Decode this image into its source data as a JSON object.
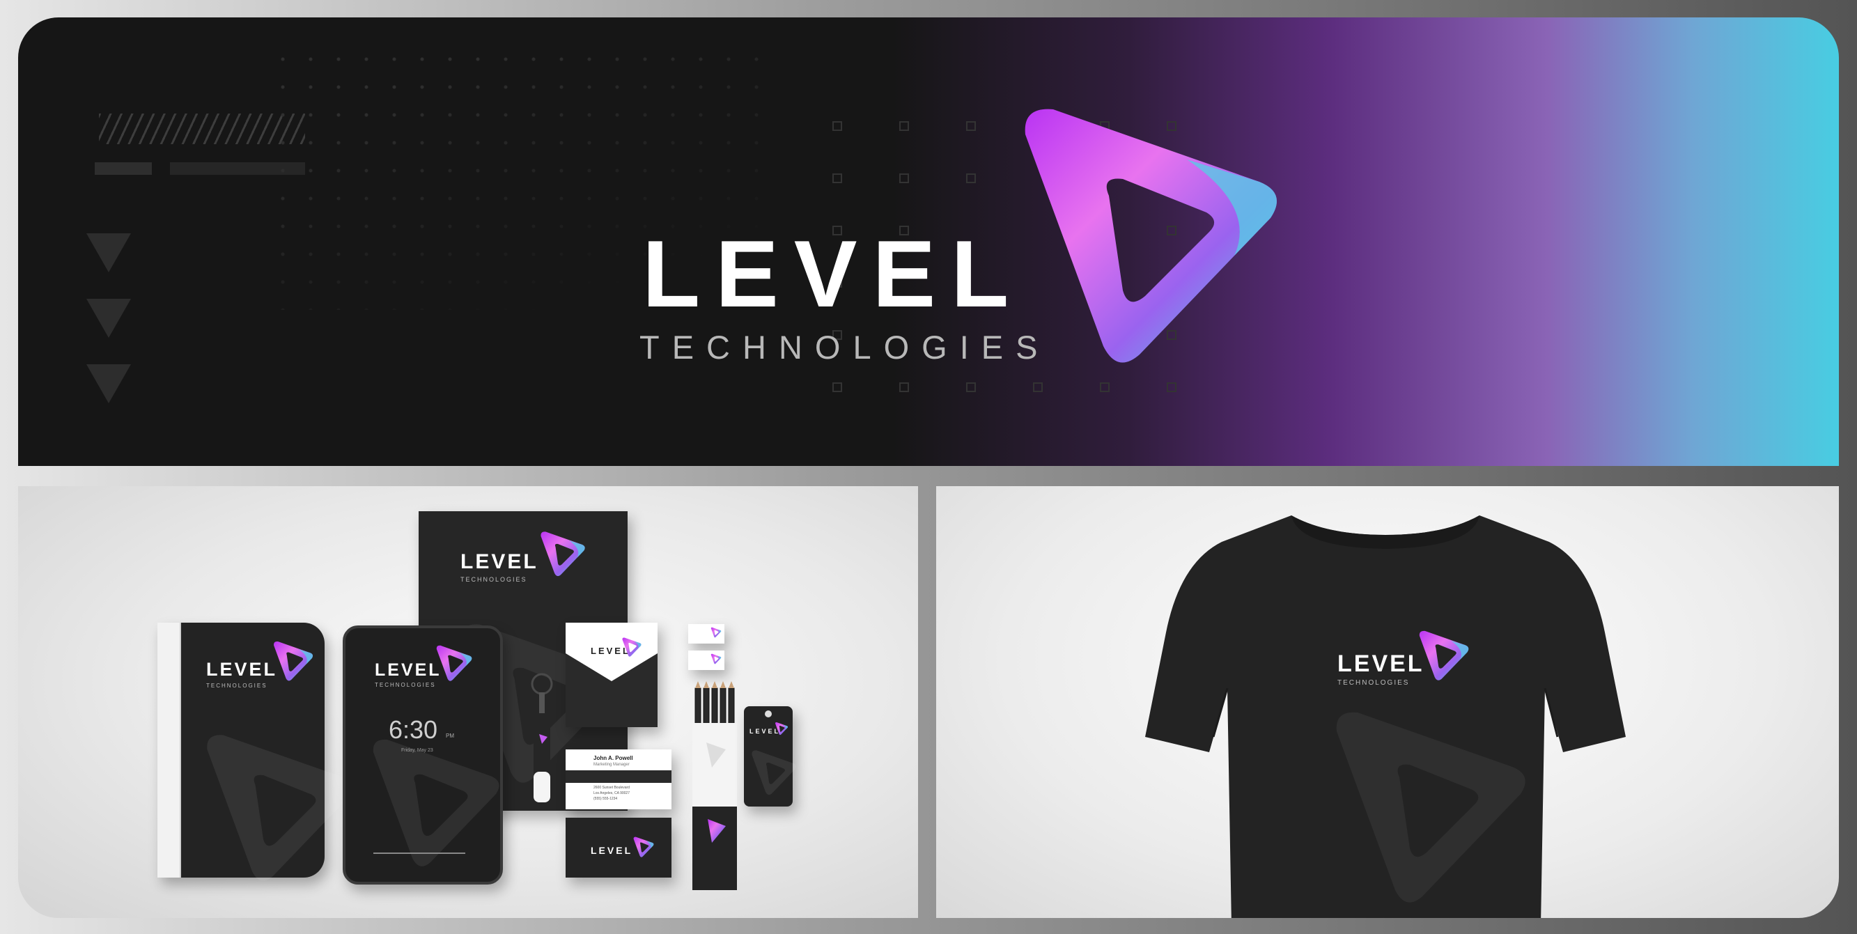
{
  "banner": {
    "brand_word": "LEVEL",
    "brand_sub": "TECHNOLOGIES"
  },
  "mockups": {
    "brand_word": "LEVEL",
    "brand_sub": "TECHNOLOGIES",
    "tablet_time": "6:30",
    "tablet_ampm": "PM",
    "tablet_date": "Friday, May 23",
    "card_name": "John A. Powell",
    "card_title": "Marketing Manager",
    "card_address_1": "2600 Sunset Boulevard",
    "card_address_2": "Los Angeles, CA 90027",
    "card_phone": "(555) 555-1234"
  },
  "icons": {
    "logo": "play-triangle-gradient-icon"
  },
  "colors": {
    "logo_gradient": [
      "#c13cf2",
      "#e771f0",
      "#b2a3ee",
      "#4fd5e8"
    ],
    "banner_dark": "#161616",
    "banner_purple": "#5c2d7e",
    "banner_cyan": "#48cde2",
    "tshirt": "#222222"
  }
}
